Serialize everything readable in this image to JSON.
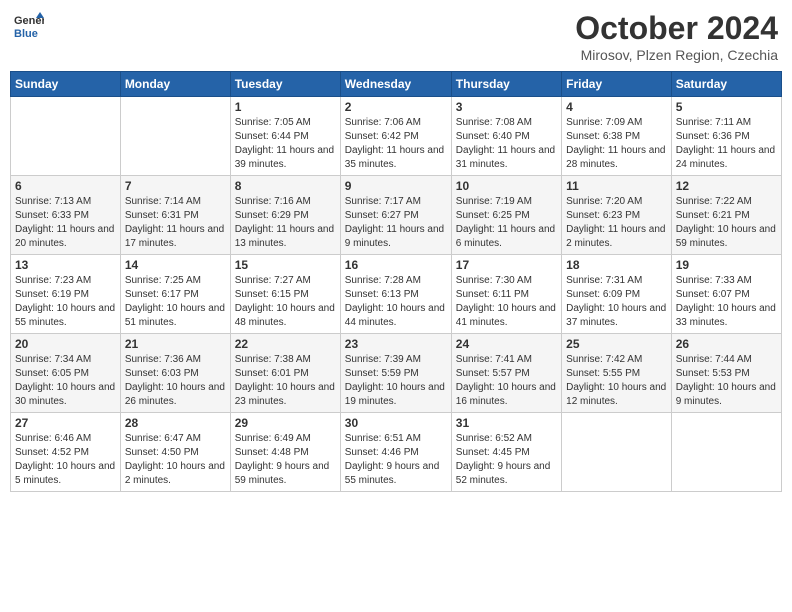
{
  "logo": {
    "general": "General",
    "blue": "Blue"
  },
  "header": {
    "month": "October 2024",
    "location": "Mirosov, Plzen Region, Czechia"
  },
  "days_of_week": [
    "Sunday",
    "Monday",
    "Tuesday",
    "Wednesday",
    "Thursday",
    "Friday",
    "Saturday"
  ],
  "weeks": [
    [
      {
        "day": "",
        "info": ""
      },
      {
        "day": "",
        "info": ""
      },
      {
        "day": "1",
        "info": "Sunrise: 7:05 AM\nSunset: 6:44 PM\nDaylight: 11 hours and 39 minutes."
      },
      {
        "day": "2",
        "info": "Sunrise: 7:06 AM\nSunset: 6:42 PM\nDaylight: 11 hours and 35 minutes."
      },
      {
        "day": "3",
        "info": "Sunrise: 7:08 AM\nSunset: 6:40 PM\nDaylight: 11 hours and 31 minutes."
      },
      {
        "day": "4",
        "info": "Sunrise: 7:09 AM\nSunset: 6:38 PM\nDaylight: 11 hours and 28 minutes."
      },
      {
        "day": "5",
        "info": "Sunrise: 7:11 AM\nSunset: 6:36 PM\nDaylight: 11 hours and 24 minutes."
      }
    ],
    [
      {
        "day": "6",
        "info": "Sunrise: 7:13 AM\nSunset: 6:33 PM\nDaylight: 11 hours and 20 minutes."
      },
      {
        "day": "7",
        "info": "Sunrise: 7:14 AM\nSunset: 6:31 PM\nDaylight: 11 hours and 17 minutes."
      },
      {
        "day": "8",
        "info": "Sunrise: 7:16 AM\nSunset: 6:29 PM\nDaylight: 11 hours and 13 minutes."
      },
      {
        "day": "9",
        "info": "Sunrise: 7:17 AM\nSunset: 6:27 PM\nDaylight: 11 hours and 9 minutes."
      },
      {
        "day": "10",
        "info": "Sunrise: 7:19 AM\nSunset: 6:25 PM\nDaylight: 11 hours and 6 minutes."
      },
      {
        "day": "11",
        "info": "Sunrise: 7:20 AM\nSunset: 6:23 PM\nDaylight: 11 hours and 2 minutes."
      },
      {
        "day": "12",
        "info": "Sunrise: 7:22 AM\nSunset: 6:21 PM\nDaylight: 10 hours and 59 minutes."
      }
    ],
    [
      {
        "day": "13",
        "info": "Sunrise: 7:23 AM\nSunset: 6:19 PM\nDaylight: 10 hours and 55 minutes."
      },
      {
        "day": "14",
        "info": "Sunrise: 7:25 AM\nSunset: 6:17 PM\nDaylight: 10 hours and 51 minutes."
      },
      {
        "day": "15",
        "info": "Sunrise: 7:27 AM\nSunset: 6:15 PM\nDaylight: 10 hours and 48 minutes."
      },
      {
        "day": "16",
        "info": "Sunrise: 7:28 AM\nSunset: 6:13 PM\nDaylight: 10 hours and 44 minutes."
      },
      {
        "day": "17",
        "info": "Sunrise: 7:30 AM\nSunset: 6:11 PM\nDaylight: 10 hours and 41 minutes."
      },
      {
        "day": "18",
        "info": "Sunrise: 7:31 AM\nSunset: 6:09 PM\nDaylight: 10 hours and 37 minutes."
      },
      {
        "day": "19",
        "info": "Sunrise: 7:33 AM\nSunset: 6:07 PM\nDaylight: 10 hours and 33 minutes."
      }
    ],
    [
      {
        "day": "20",
        "info": "Sunrise: 7:34 AM\nSunset: 6:05 PM\nDaylight: 10 hours and 30 minutes."
      },
      {
        "day": "21",
        "info": "Sunrise: 7:36 AM\nSunset: 6:03 PM\nDaylight: 10 hours and 26 minutes."
      },
      {
        "day": "22",
        "info": "Sunrise: 7:38 AM\nSunset: 6:01 PM\nDaylight: 10 hours and 23 minutes."
      },
      {
        "day": "23",
        "info": "Sunrise: 7:39 AM\nSunset: 5:59 PM\nDaylight: 10 hours and 19 minutes."
      },
      {
        "day": "24",
        "info": "Sunrise: 7:41 AM\nSunset: 5:57 PM\nDaylight: 10 hours and 16 minutes."
      },
      {
        "day": "25",
        "info": "Sunrise: 7:42 AM\nSunset: 5:55 PM\nDaylight: 10 hours and 12 minutes."
      },
      {
        "day": "26",
        "info": "Sunrise: 7:44 AM\nSunset: 5:53 PM\nDaylight: 10 hours and 9 minutes."
      }
    ],
    [
      {
        "day": "27",
        "info": "Sunrise: 6:46 AM\nSunset: 4:52 PM\nDaylight: 10 hours and 5 minutes."
      },
      {
        "day": "28",
        "info": "Sunrise: 6:47 AM\nSunset: 4:50 PM\nDaylight: 10 hours and 2 minutes."
      },
      {
        "day": "29",
        "info": "Sunrise: 6:49 AM\nSunset: 4:48 PM\nDaylight: 9 hours and 59 minutes."
      },
      {
        "day": "30",
        "info": "Sunrise: 6:51 AM\nSunset: 4:46 PM\nDaylight: 9 hours and 55 minutes."
      },
      {
        "day": "31",
        "info": "Sunrise: 6:52 AM\nSunset: 4:45 PM\nDaylight: 9 hours and 52 minutes."
      },
      {
        "day": "",
        "info": ""
      },
      {
        "day": "",
        "info": ""
      }
    ]
  ]
}
